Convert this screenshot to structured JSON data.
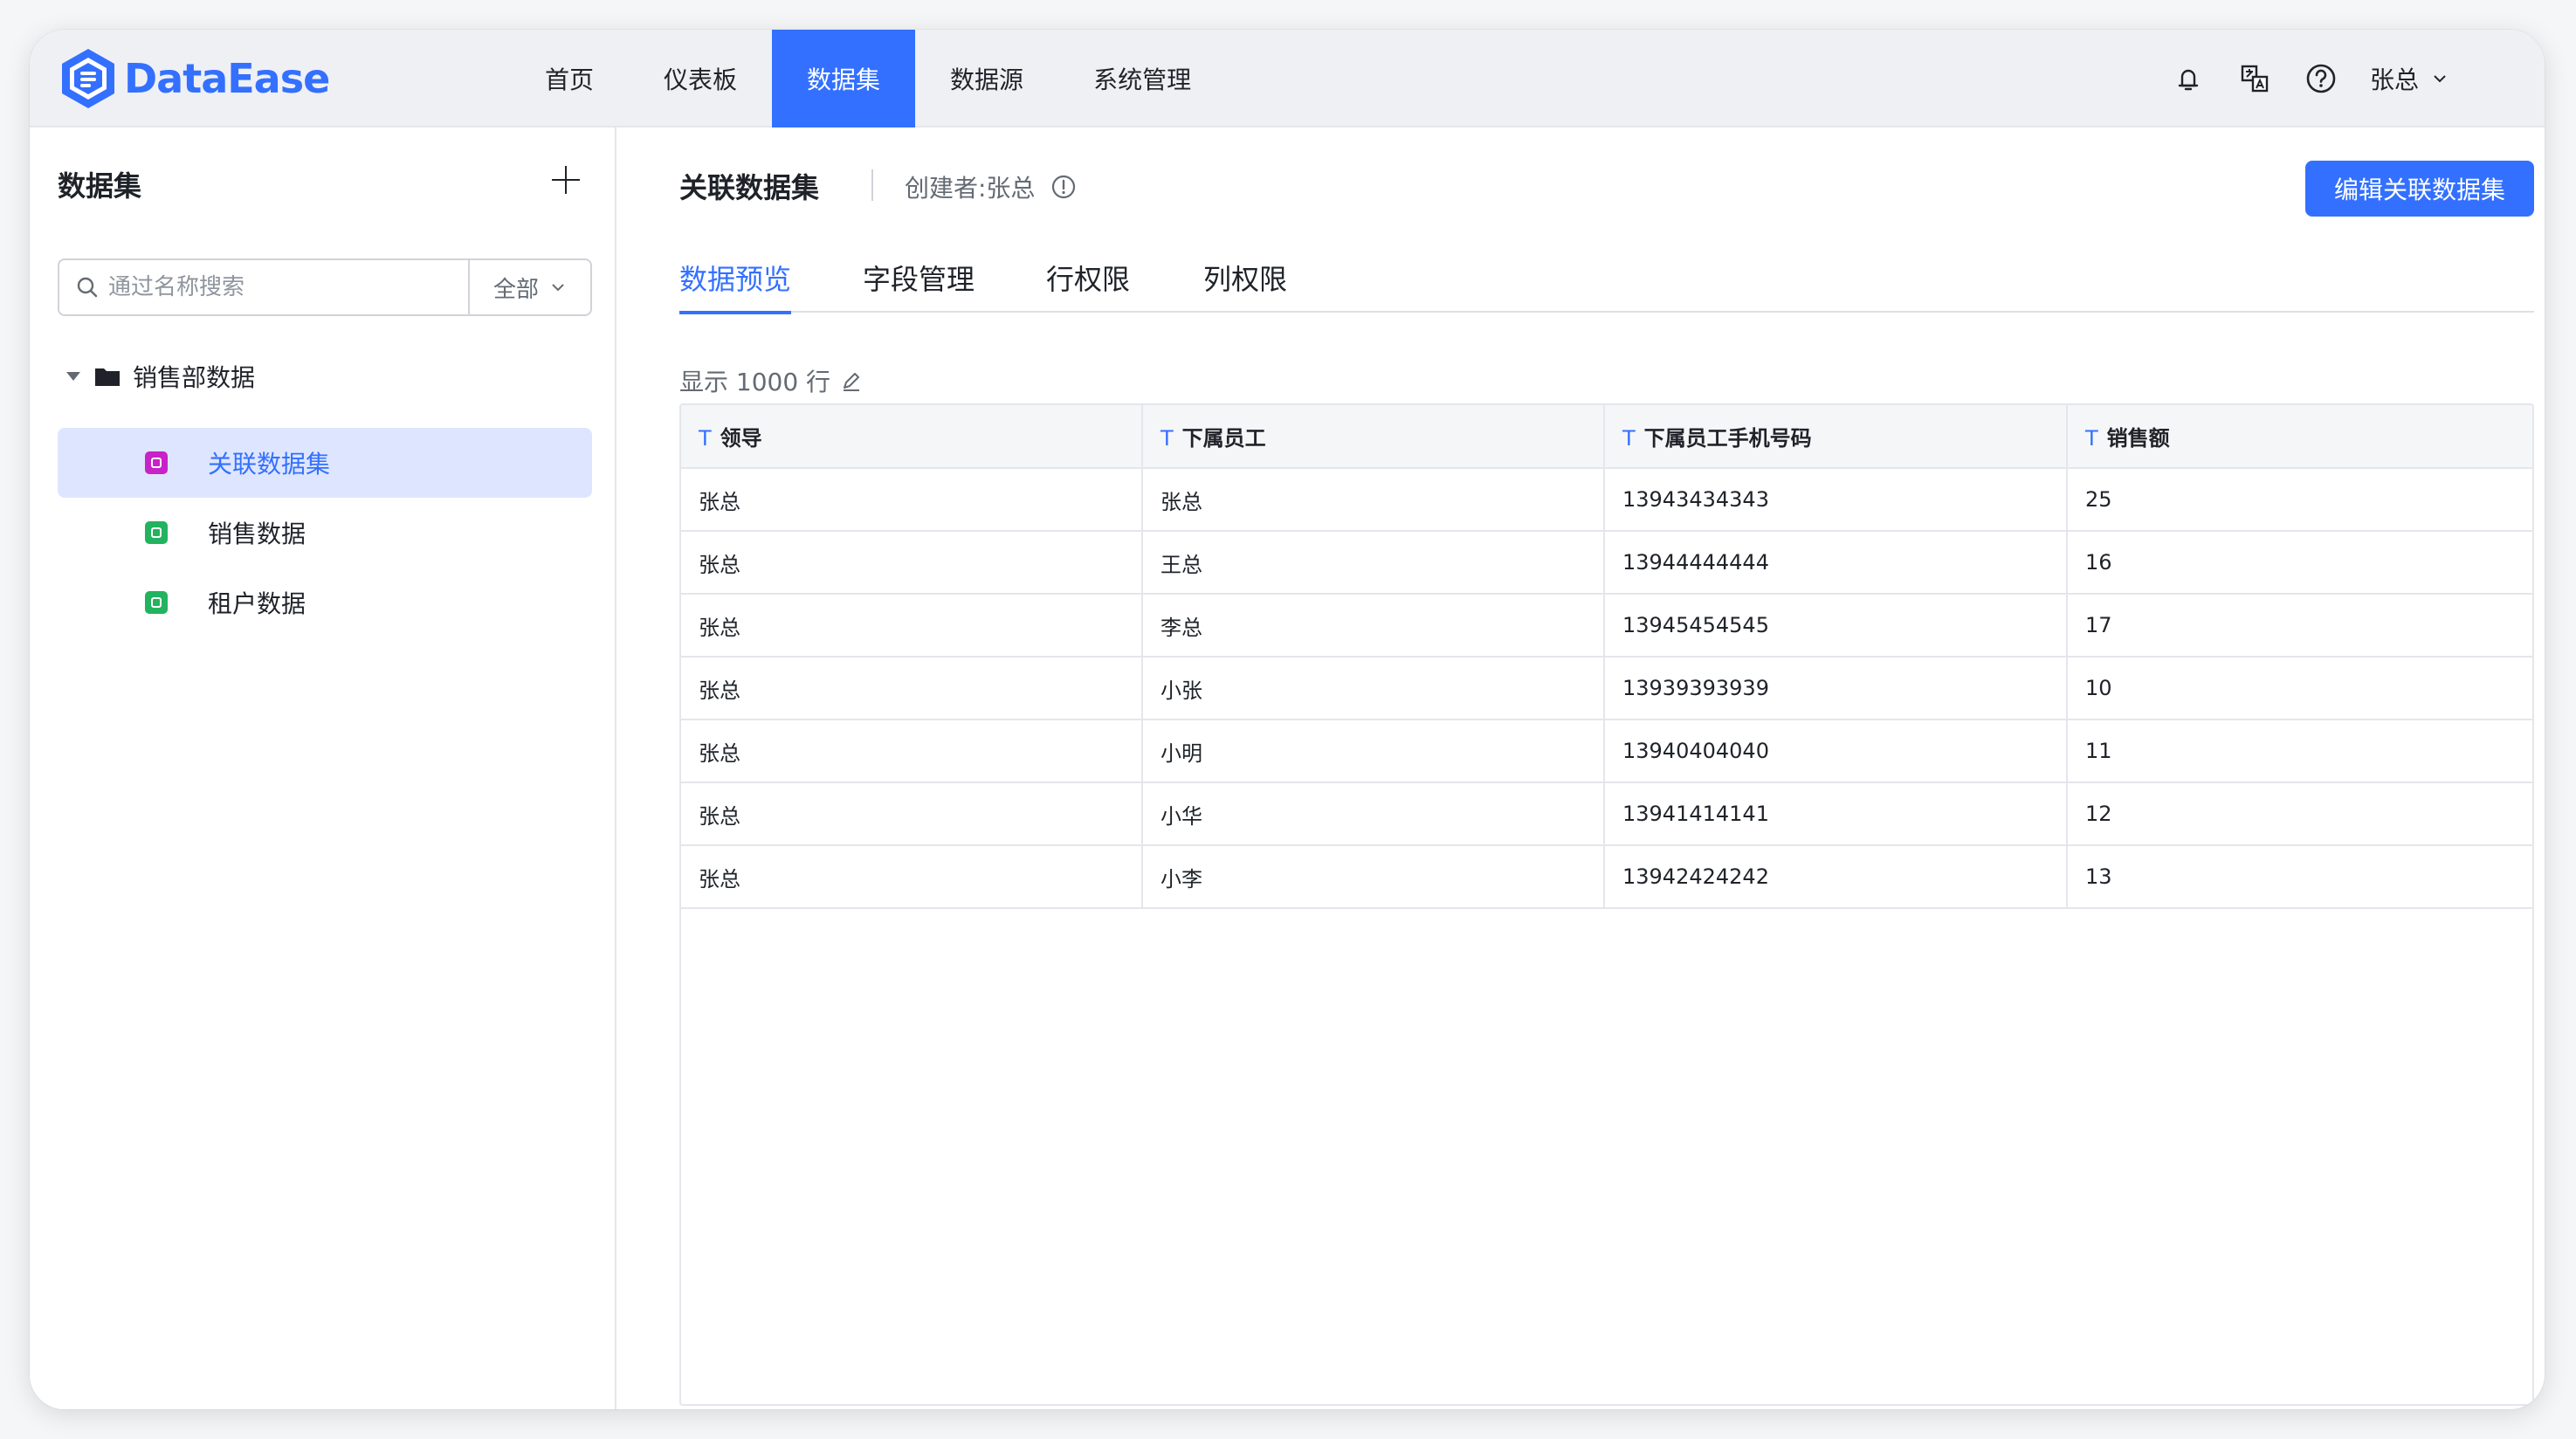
{
  "app": {
    "name": "DataEase",
    "brand_color": "#3370ff"
  },
  "nav": {
    "items": [
      {
        "label": "首页"
      },
      {
        "label": "仪表板"
      },
      {
        "label": "数据集"
      },
      {
        "label": "数据源"
      },
      {
        "label": "系统管理"
      }
    ],
    "active_index": 2
  },
  "topbar": {
    "icons": [
      "bell-icon",
      "translate-icon",
      "help-icon"
    ],
    "user_name": "张总"
  },
  "sidebar": {
    "title": "数据集",
    "search": {
      "placeholder": "通过名称搜索",
      "filter_value": "全部"
    },
    "folder": {
      "label": "销售部数据"
    },
    "items": [
      {
        "label": "关联数据集",
        "icon_color": "#c822c8",
        "active": true
      },
      {
        "label": "销售数据",
        "icon_color": "#22b35e",
        "active": false
      },
      {
        "label": "租户数据",
        "icon_color": "#22b35e",
        "active": false
      }
    ]
  },
  "main": {
    "title": "关联数据集",
    "creator": "创建者:张总",
    "edit_button": "编辑关联数据集",
    "tabs": [
      {
        "label": "数据预览"
      },
      {
        "label": "字段管理"
      },
      {
        "label": "行权限"
      },
      {
        "label": "列权限"
      }
    ],
    "active_tab": 0,
    "row_count": "显示 1000 行",
    "table": {
      "type_marker": "T",
      "columns": [
        "领导",
        "下属员工",
        "下属员工手机号码",
        "销售额"
      ],
      "rows": [
        [
          "张总",
          "张总",
          "13943434343",
          "25"
        ],
        [
          "张总",
          "王总",
          "13944444444",
          "16"
        ],
        [
          "张总",
          "李总",
          "13945454545",
          "17"
        ],
        [
          "张总",
          "小张",
          "13939393939",
          "10"
        ],
        [
          "张总",
          "小明",
          "13940404040",
          "11"
        ],
        [
          "张总",
          "小华",
          "13941414141",
          "12"
        ],
        [
          "张总",
          "小李",
          "13942424242",
          "13"
        ]
      ]
    }
  }
}
